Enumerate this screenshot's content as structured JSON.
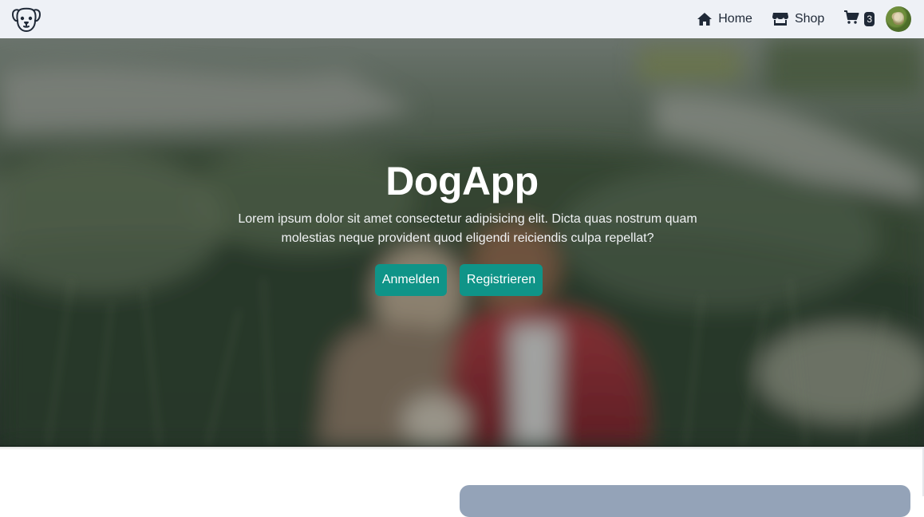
{
  "navbar": {
    "logo_icon": "dog-face-icon",
    "links": [
      {
        "label": "Home",
        "icon": "home-icon"
      },
      {
        "label": "Shop",
        "icon": "store-icon"
      }
    ],
    "cart": {
      "icon": "cart-icon",
      "count": "3"
    },
    "avatar_icon": "user-avatar"
  },
  "hero": {
    "title": "DogApp",
    "text": "Lorem ipsum dolor sit amet consectetur adipisicing elit. Dicta quas nostrum quam molestias neque provident quod eligendi reiciendis culpa repellat?",
    "login_label": "Anmelden",
    "register_label": "Registrieren"
  },
  "colors": {
    "navbar_bg": "#eef1f6",
    "button_bg": "#0f9488",
    "card_bg": "#94a3b8"
  }
}
